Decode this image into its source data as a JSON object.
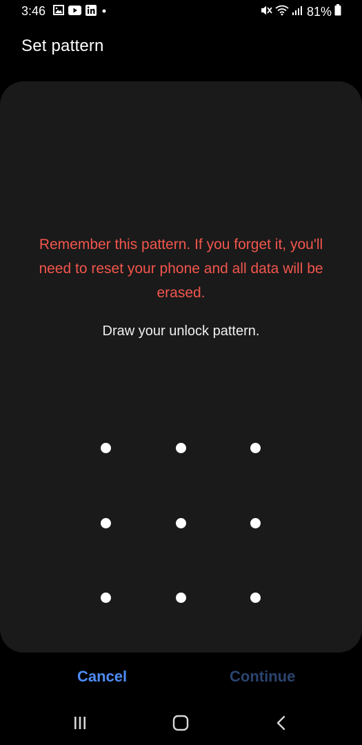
{
  "status_bar": {
    "time": "3:46",
    "battery_percent": "81%",
    "icons_left": [
      "gallery-icon",
      "youtube-icon",
      "linkedin-icon",
      "notification-dot-icon"
    ],
    "icons_right": [
      "mute-icon",
      "wifi-icon",
      "signal-icon",
      "battery-icon"
    ]
  },
  "header": {
    "title": "Set pattern"
  },
  "card": {
    "warning": "Remember this pattern. If you forget it, you'll need to reset your phone and all data will be erased.",
    "instruction": "Draw your unlock pattern.",
    "pattern_dots": 9
  },
  "actions": {
    "cancel_label": "Cancel",
    "continue_label": "Continue",
    "continue_enabled": false
  },
  "nav_bar": {
    "buttons": [
      "recent-apps-icon",
      "home-icon",
      "back-icon"
    ]
  },
  "colors": {
    "background": "#000000",
    "card": "#1a1a1a",
    "warning": "#f2564d",
    "accent": "#4e8cf5",
    "disabled_accent": "#2b4470"
  }
}
